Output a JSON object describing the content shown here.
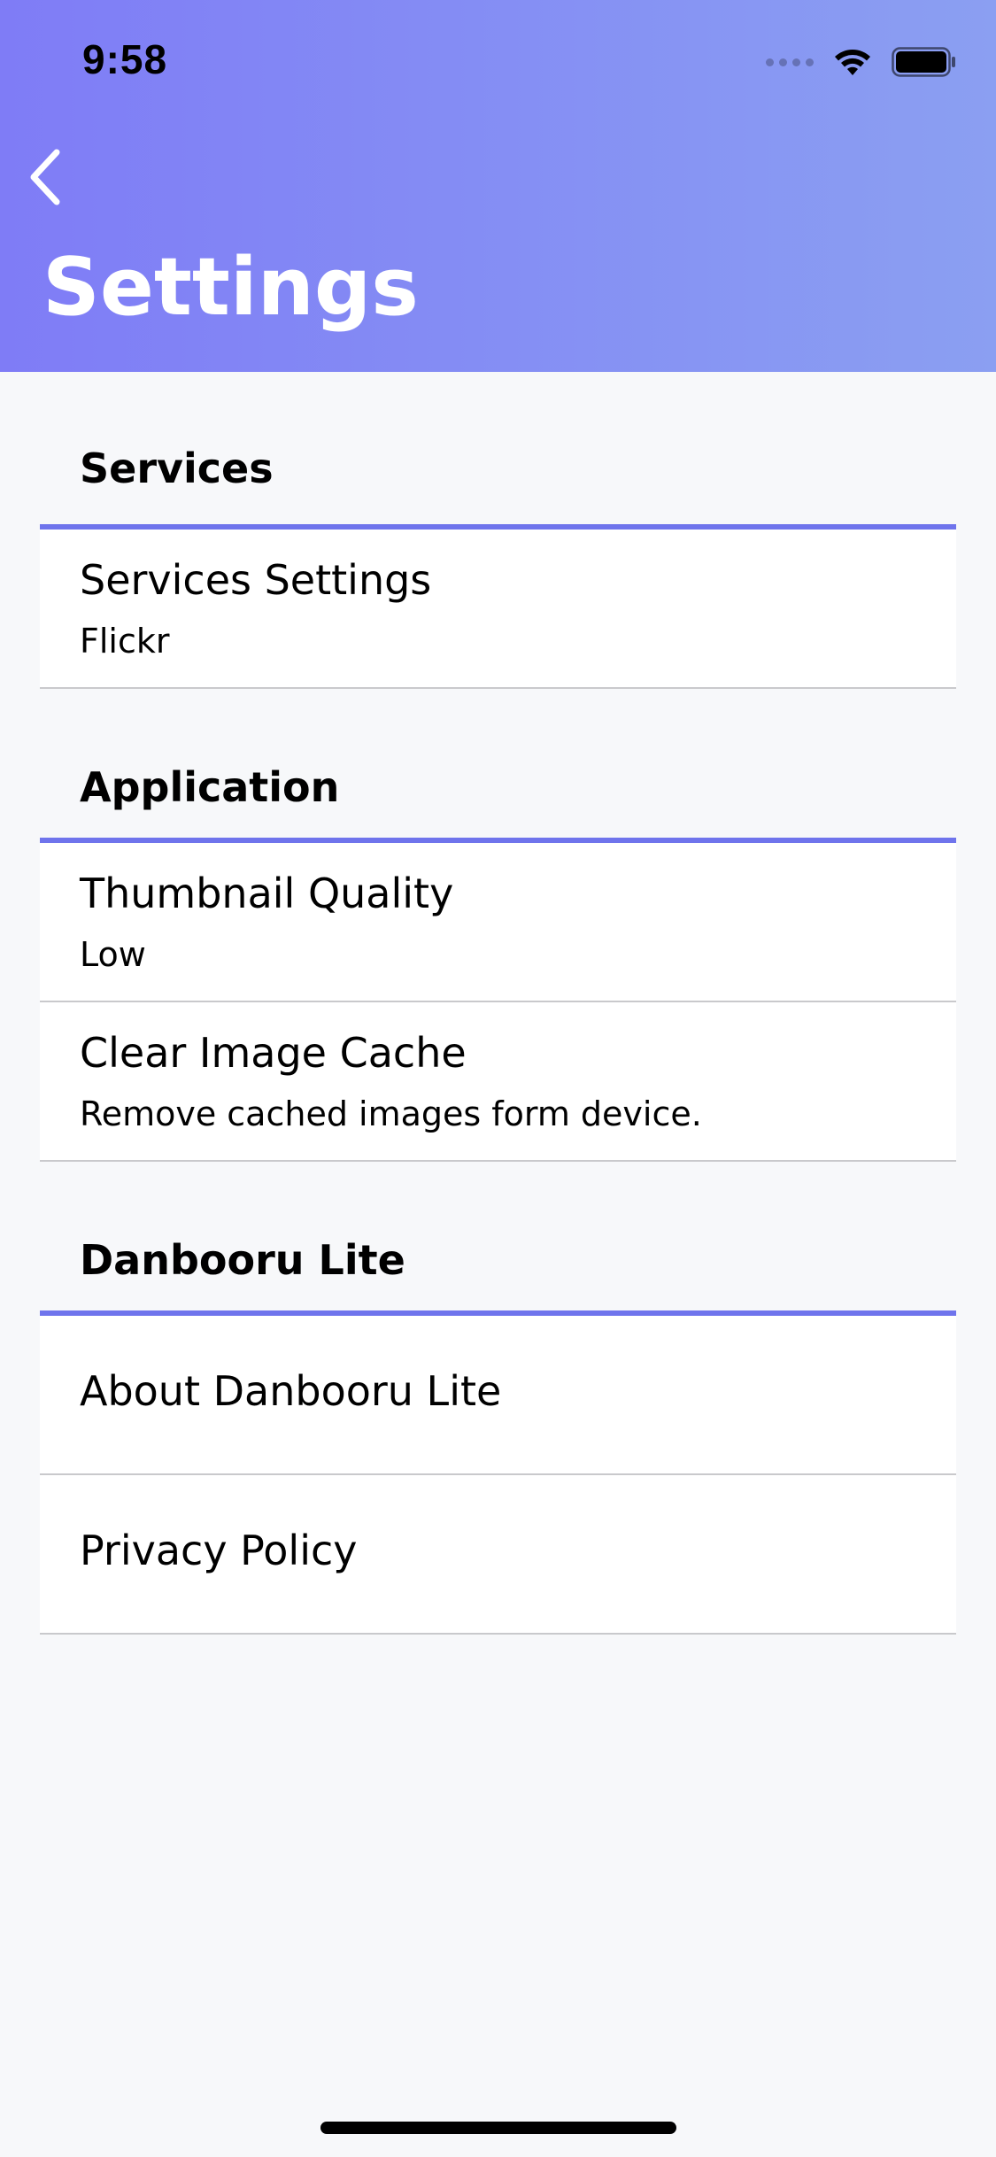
{
  "status_bar": {
    "time": "9:58"
  },
  "header": {
    "title": "Settings",
    "back_icon": "chevron-left-icon"
  },
  "colors": {
    "header_gradient_start": "#7f7cf6",
    "header_gradient_end": "#8b9ff2",
    "section_divider": "#6f74ec",
    "background": "#f7f8fa"
  },
  "sections": [
    {
      "title": "Services",
      "rows": [
        {
          "title": "Services Settings",
          "subtitle": "Flickr"
        }
      ]
    },
    {
      "title": "Application",
      "rows": [
        {
          "title": "Thumbnail Quality",
          "subtitle": "Low"
        },
        {
          "title": "Clear Image Cache",
          "subtitle": "Remove cached images form device."
        }
      ]
    },
    {
      "title": "Danbooru Lite",
      "rows": [
        {
          "title": "About Danbooru Lite"
        },
        {
          "title": "Privacy Policy"
        }
      ]
    }
  ]
}
